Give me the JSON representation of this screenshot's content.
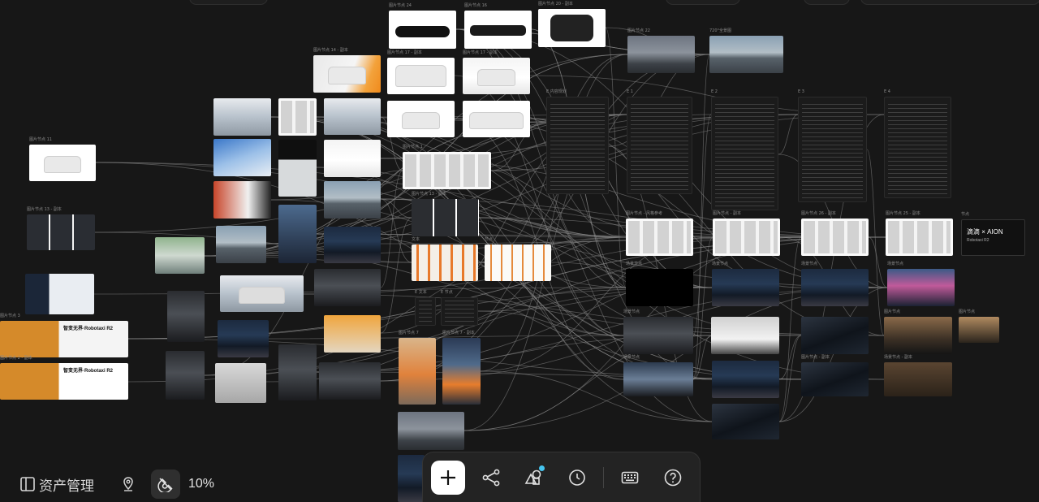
{
  "colors": {
    "background": "#171717",
    "accent_dot": "#45c4ef",
    "wire": "#8a8a8a"
  },
  "left_bar": {
    "asset_label": "资产管理",
    "asset_icon": "panel-layout-icon",
    "locate_icon": "map-pin-icon",
    "magnet_icon": "magnet-snap-icon",
    "zoom": "10%"
  },
  "toolbar": {
    "add_icon": "plus-icon",
    "workflow_icon": "workflow-nodes-icon",
    "shapes_icon": "shapes-icon",
    "history_icon": "clock-icon",
    "keyboard_icon": "keyboard-icon",
    "help_icon": "question-circle-icon"
  },
  "nodes": {
    "n_top1": "图片节点 24",
    "n_top2": "图片节点 16",
    "n_top3": "图片节点 20 - 副本",
    "n_city1": "图片节点 22",
    "n_city2": "720°全景图",
    "n_showcar": "图片节点 14 - 副本",
    "n_car_front": "图片节点 17 - 副本",
    "n_car_side": "图片节点 17 - 副本",
    "n_left_car": "图片节点 11",
    "n_left_interior": "图片节点 13 - 副本",
    "n_left_ad1": "图片节点 3",
    "n_left_ad2": "图片节点 2 - 副本",
    "n_grid": "图片节点 1",
    "n_grid2": "图片节点 13 - 副本",
    "n_people1": "文本",
    "n_people2": "节点",
    "n_girl": "图片节点 7",
    "n_boy": "图片节点 7 - 副本",
    "n_t1": "E 文本",
    "n_t2": "E 节点",
    "n_doc0": "E 内容规划",
    "n_doc1": "E 1",
    "n_doc2": "E 2",
    "n_doc3": "E 3",
    "n_doc4": "E 4",
    "n_sheet1": "图片节点 - 风格参考",
    "n_sheet2": "图片节点 - 副本",
    "n_sheet3": "图片节点 26 - 副本",
    "n_sheet4": "图片节点 25 - 副本",
    "n_brand": "节点",
    "n_black": "场景节点",
    "n_night1": "场景节点",
    "n_night2": "场景节点",
    "n_night3": "场景节点",
    "n_cockpit1": "场景节点",
    "n_cockpit2": "场景节点",
    "n_street": "图片节点",
    "n_street2": "图片节点",
    "n_sm": "图片节点 - 副本",
    "n_showroom": "场景节点 - 副本"
  },
  "ad_headline": "智变无界·Robotaxi R2",
  "brand_text": "滴滴 × AION",
  "brand_sub": "Robotaxi R2"
}
